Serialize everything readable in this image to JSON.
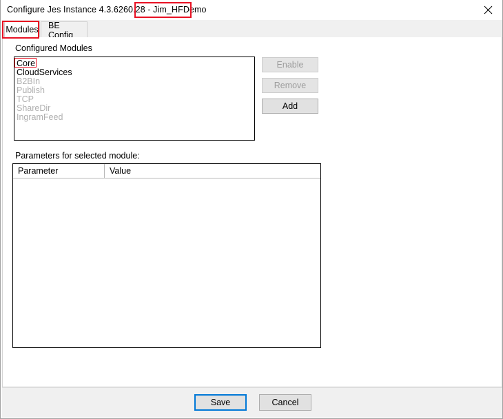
{
  "window": {
    "title_prefix": "Configure Jes Instance 4.3.6260.28 - ",
    "title_full": "Configure Jes Instance 4.3.6260.28 - Jim_HFDemo",
    "instance_name": "Jim_HFDemo",
    "close_icon": "close-icon",
    "highlight_color": "#e81123",
    "focus_color": "#0078d7"
  },
  "tabs": [
    {
      "label": "Modules",
      "active": true
    },
    {
      "label": "BE Config",
      "active": false
    }
  ],
  "modules_section": {
    "label": "Configured Modules",
    "items": [
      {
        "name": "Core",
        "enabled": true,
        "selected": true
      },
      {
        "name": "CloudServices",
        "enabled": true,
        "selected": false
      },
      {
        "name": "B2BIn",
        "enabled": false,
        "selected": false
      },
      {
        "name": "Publish",
        "enabled": false,
        "selected": false
      },
      {
        "name": "TCP",
        "enabled": false,
        "selected": false
      },
      {
        "name": "ShareDir",
        "enabled": false,
        "selected": false
      },
      {
        "name": "IngramFeed",
        "enabled": false,
        "selected": false
      }
    ],
    "buttons": [
      {
        "label": "Enable",
        "disabled": true
      },
      {
        "label": "Remove",
        "disabled": true
      },
      {
        "label": "Add",
        "disabled": false
      }
    ]
  },
  "parameters_section": {
    "label": "Parameters for selected module:",
    "columns": [
      "Parameter",
      "Value"
    ],
    "rows": []
  },
  "footer": {
    "save_label": "Save",
    "cancel_label": "Cancel"
  }
}
